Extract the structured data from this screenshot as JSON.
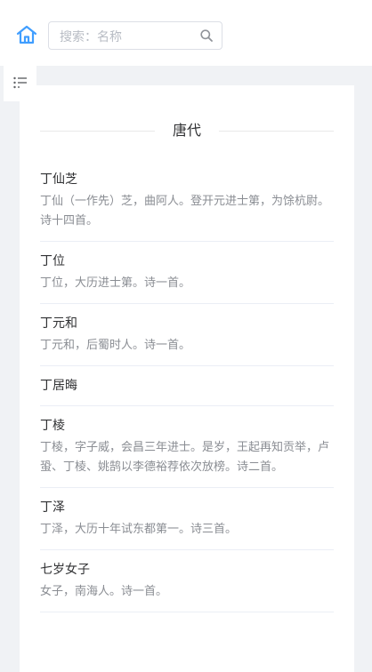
{
  "header": {
    "search_placeholder": "搜索：名称",
    "search_value": ""
  },
  "section": {
    "title": "唐代"
  },
  "poets": [
    {
      "name": "丁仙芝",
      "desc": "丁仙（一作先）芝，曲阿人。登开元进士第，为馀杭尉。诗十四首。"
    },
    {
      "name": "丁位",
      "desc": "丁位，大历进士第。诗一首。"
    },
    {
      "name": "丁元和",
      "desc": "丁元和，后蜀时人。诗一首。"
    },
    {
      "name": "丁居晦",
      "desc": ""
    },
    {
      "name": "丁棱",
      "desc": "丁棱，字子威，会昌三年进士。是岁，王起再知贡举，卢蛩、丁棱、姚鹄以李德裕荐依次放榜。诗二首。"
    },
    {
      "name": "丁泽",
      "desc": "丁泽，大历十年试东都第一。诗三首。"
    },
    {
      "name": "七岁女子",
      "desc": "女子，南海人。诗一首。"
    }
  ],
  "colors": {
    "accent": "#409eff",
    "page_bg": "#f0f2f5"
  },
  "icons": {
    "home": "home-icon",
    "search": "search-icon",
    "menu": "menu-list-icon"
  }
}
